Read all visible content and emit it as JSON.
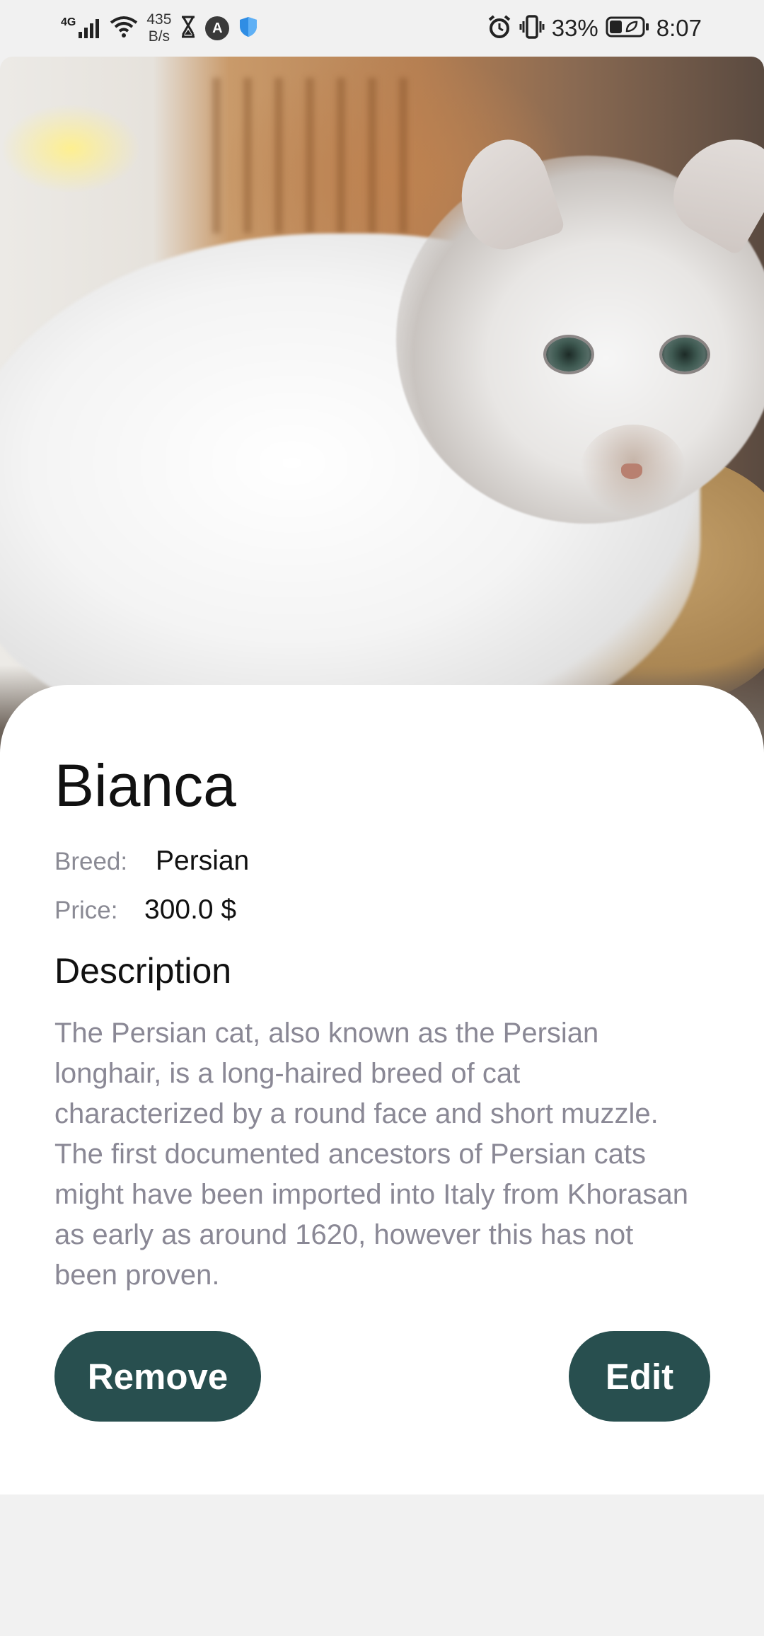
{
  "status_bar": {
    "network": "4G",
    "speed_value": "435",
    "speed_unit": "B/s",
    "app_icon_letter": "A",
    "battery": "33%",
    "time": "8:07",
    "icons": [
      "signal-icon",
      "wifi-icon",
      "hourglass-icon",
      "app-icon",
      "shield-icon",
      "alarm-icon",
      "vibrate-icon",
      "battery-icon"
    ]
  },
  "pet": {
    "name": "Bianca",
    "breed_label": "Breed:",
    "breed": "Persian",
    "price_label": "Price:",
    "price": "300.0 $",
    "photo": "white persian cat lying near a wicker basket"
  },
  "description": {
    "title": "Description",
    "text": "The Persian cat, also known as the Persian longhair, is a long-haired breed of cat characterized by a round face and short muzzle. The first documented ancestors of Persian cats might have been imported into Italy from Khorasan as early as around 1620, however this has not been proven."
  },
  "actions": {
    "remove_label": "Remove",
    "edit_label": "Edit"
  },
  "colors": {
    "button": "#284f4f",
    "background": "#f1f1f1",
    "card": "#ffffff",
    "muted_text": "#8a8895"
  }
}
